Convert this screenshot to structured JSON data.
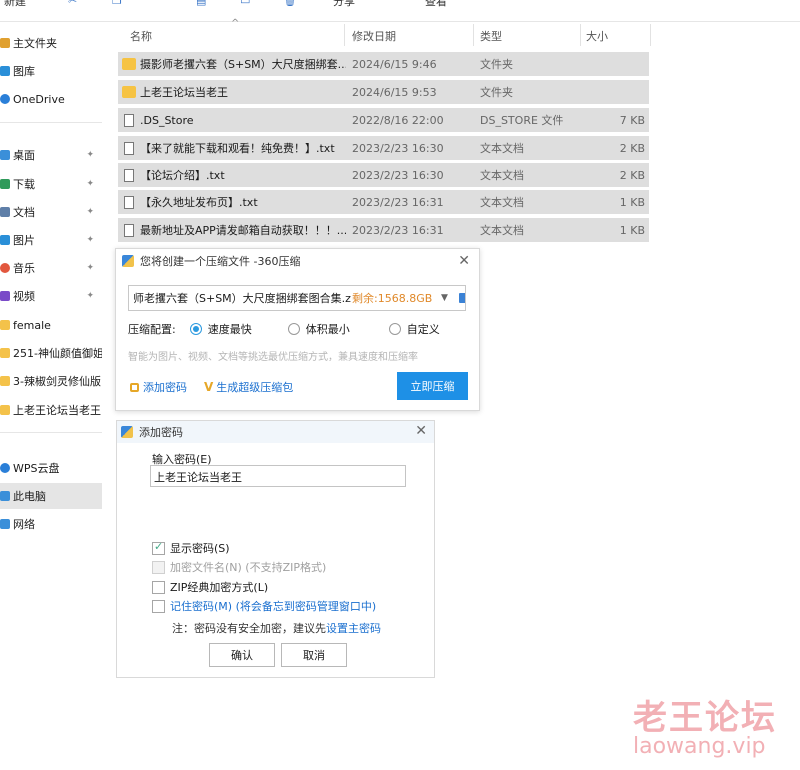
{
  "toolbar": {
    "new_label": "新建",
    "share_label": "分享",
    "view_label": "查看"
  },
  "sidebar": {
    "items": [
      {
        "label": "主文件夹",
        "icon": "home-icon",
        "color": "#e0a030"
      },
      {
        "label": "图库",
        "icon": "gallery-icon",
        "color": "#2a8fd8"
      },
      {
        "label": "OneDrive",
        "icon": "cloud-icon",
        "color": "#2a7fd8"
      },
      {
        "label": "桌面",
        "icon": "desktop-icon",
        "color": "#3b8fd9",
        "pinned": true
      },
      {
        "label": "下载",
        "icon": "download-icon",
        "color": "#2f9a5a",
        "pinned": true
      },
      {
        "label": "文档",
        "icon": "document-icon",
        "color": "#5f7fa8",
        "pinned": true
      },
      {
        "label": "图片",
        "icon": "pictures-icon",
        "color": "#2a8fd8",
        "pinned": true
      },
      {
        "label": "音乐",
        "icon": "music-icon",
        "color": "#e2573e",
        "pinned": true
      },
      {
        "label": "视频",
        "icon": "video-icon",
        "color": "#7a4bc8",
        "pinned": true
      },
      {
        "label": "female",
        "icon": "folder-icon",
        "color": "#f4c24a"
      },
      {
        "label": "251-神仙颜值御姐",
        "icon": "folder-icon",
        "color": "#f4c24a"
      },
      {
        "label": "3-辣椒剑灵修仙版",
        "icon": "folder-icon",
        "color": "#f4c24a"
      },
      {
        "label": "上老王论坛当老王",
        "icon": "folder-icon",
        "color": "#f4c24a"
      },
      {
        "label": "WPS云盘",
        "icon": "wps-cloud-icon",
        "color": "#2a7fd8"
      },
      {
        "label": "此电脑",
        "icon": "computer-icon",
        "color": "#3b8fd9",
        "selected": true
      },
      {
        "label": "网络",
        "icon": "network-icon",
        "color": "#3b8fd9"
      }
    ],
    "pin_glyph": "📌"
  },
  "file_list": {
    "headers": {
      "name": "名称",
      "date": "修改日期",
      "type": "类型",
      "size": "大小"
    },
    "rows": [
      {
        "name": "摄影师老攫六套（S+SM）大尺度捆绑套...",
        "date": "2024/6/15 9:46",
        "type": "文件夹",
        "size": "",
        "kind": "folder"
      },
      {
        "name": "上老王论坛当老王",
        "date": "2024/6/15 9:53",
        "type": "文件夹",
        "size": "",
        "kind": "folder"
      },
      {
        "name": ".DS_Store",
        "date": "2022/8/16 22:00",
        "type": "DS_STORE 文件",
        "size": "7 KB",
        "kind": "file"
      },
      {
        "name": "【来了就能下载和观看！纯免费！】.txt",
        "date": "2023/2/23 16:30",
        "type": "文本文档",
        "size": "2 KB",
        "kind": "file"
      },
      {
        "name": "【论坛介绍】.txt",
        "date": "2023/2/23 16:30",
        "type": "文本文档",
        "size": "2 KB",
        "kind": "file"
      },
      {
        "name": "【永久地址发布页】.txt",
        "date": "2023/2/23 16:31",
        "type": "文本文档",
        "size": "1 KB",
        "kind": "file"
      },
      {
        "name": "最新地址及APP请发邮箱自动获取！！！...",
        "date": "2023/2/23 16:31",
        "type": "文本文档",
        "size": "1 KB",
        "kind": "file"
      }
    ]
  },
  "compress_dialog": {
    "title": "您将创建一个压缩文件 -360压缩",
    "path": "师老攫六套（S+SM）大尺度捆绑套图合集.zip",
    "remaining": "剩余:1568.8GB",
    "config_label": "压缩配置:",
    "options": [
      "速度最快",
      "体积最小",
      "自定义"
    ],
    "selected_option": "速度最快",
    "hint": "智能为图片、视频、文档等挑选最优压缩方式，兼具速度和压缩率",
    "add_password": "添加密码",
    "super_pack": "生成超级压缩包",
    "compress_button": "立即压缩",
    "close_glyph": "✕",
    "accent": "#1e90e6"
  },
  "password_dialog": {
    "title": "添加密码",
    "input_label": "输入密码(E)",
    "password_value": "上老王论坛当老王",
    "checkboxes": [
      {
        "label": "显示密码(S)",
        "checked": true,
        "disabled": false
      },
      {
        "label": "加密文件名(N)  (不支持ZIP格式)",
        "checked": false,
        "disabled": true
      },
      {
        "label": "ZIP经典加密方式(L)",
        "checked": false,
        "disabled": false
      },
      {
        "label": "记住密码(M)  (将会备忘到密码管理窗口中)",
        "checked": false,
        "disabled": false
      }
    ],
    "note_prefix": "注：密码没有安全加密，建议先",
    "note_link": "设置主密码",
    "ok_button": "确认",
    "cancel_button": "取消",
    "close_glyph": "✕"
  },
  "watermark": {
    "cn": "老王论坛",
    "url": "laowang.vip"
  }
}
